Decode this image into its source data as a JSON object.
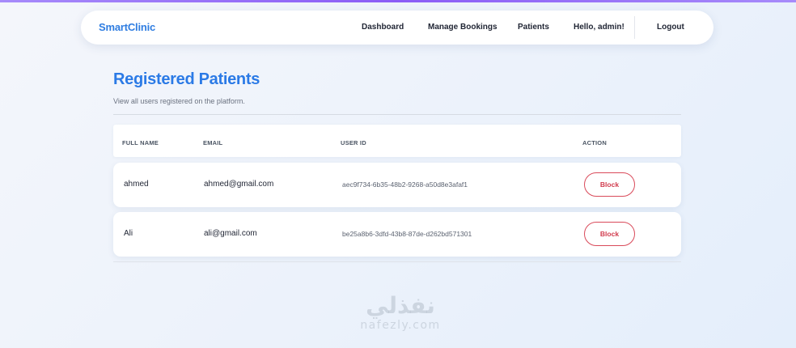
{
  "navbar": {
    "brand": "SmartClinic",
    "links": [
      {
        "label": "Dashboard"
      },
      {
        "label": "Manage Bookings"
      },
      {
        "label": "Patients"
      }
    ],
    "greeting": "Hello, admin!",
    "logout_label": "Logout"
  },
  "page": {
    "title": "Registered Patients",
    "subtitle": "View all users registered on the platform."
  },
  "table": {
    "headers": {
      "full_name": "FULL NAME",
      "email": "EMAIL",
      "user_id": "USER ID",
      "action": "ACTION"
    },
    "rows": [
      {
        "full_name": "ahmed",
        "email": "ahmed@gmail.com",
        "user_id": "aec9f734-6b35-48b2-9268-a50d8e3afaf1",
        "action_label": "Block"
      },
      {
        "full_name": "Ali",
        "email": "ali@gmail.com",
        "user_id": "be25a8b6-3dfd-43b8-87de-d262bd571301",
        "action_label": "Block"
      }
    ]
  },
  "watermark": {
    "arabic": "نفذلي",
    "latin": "nafezly.com"
  },
  "colors": {
    "brand": "#2f7de1",
    "title": "#2b7ae6",
    "danger": "#d13b4d",
    "accent_bar": "#8b5cf6"
  }
}
